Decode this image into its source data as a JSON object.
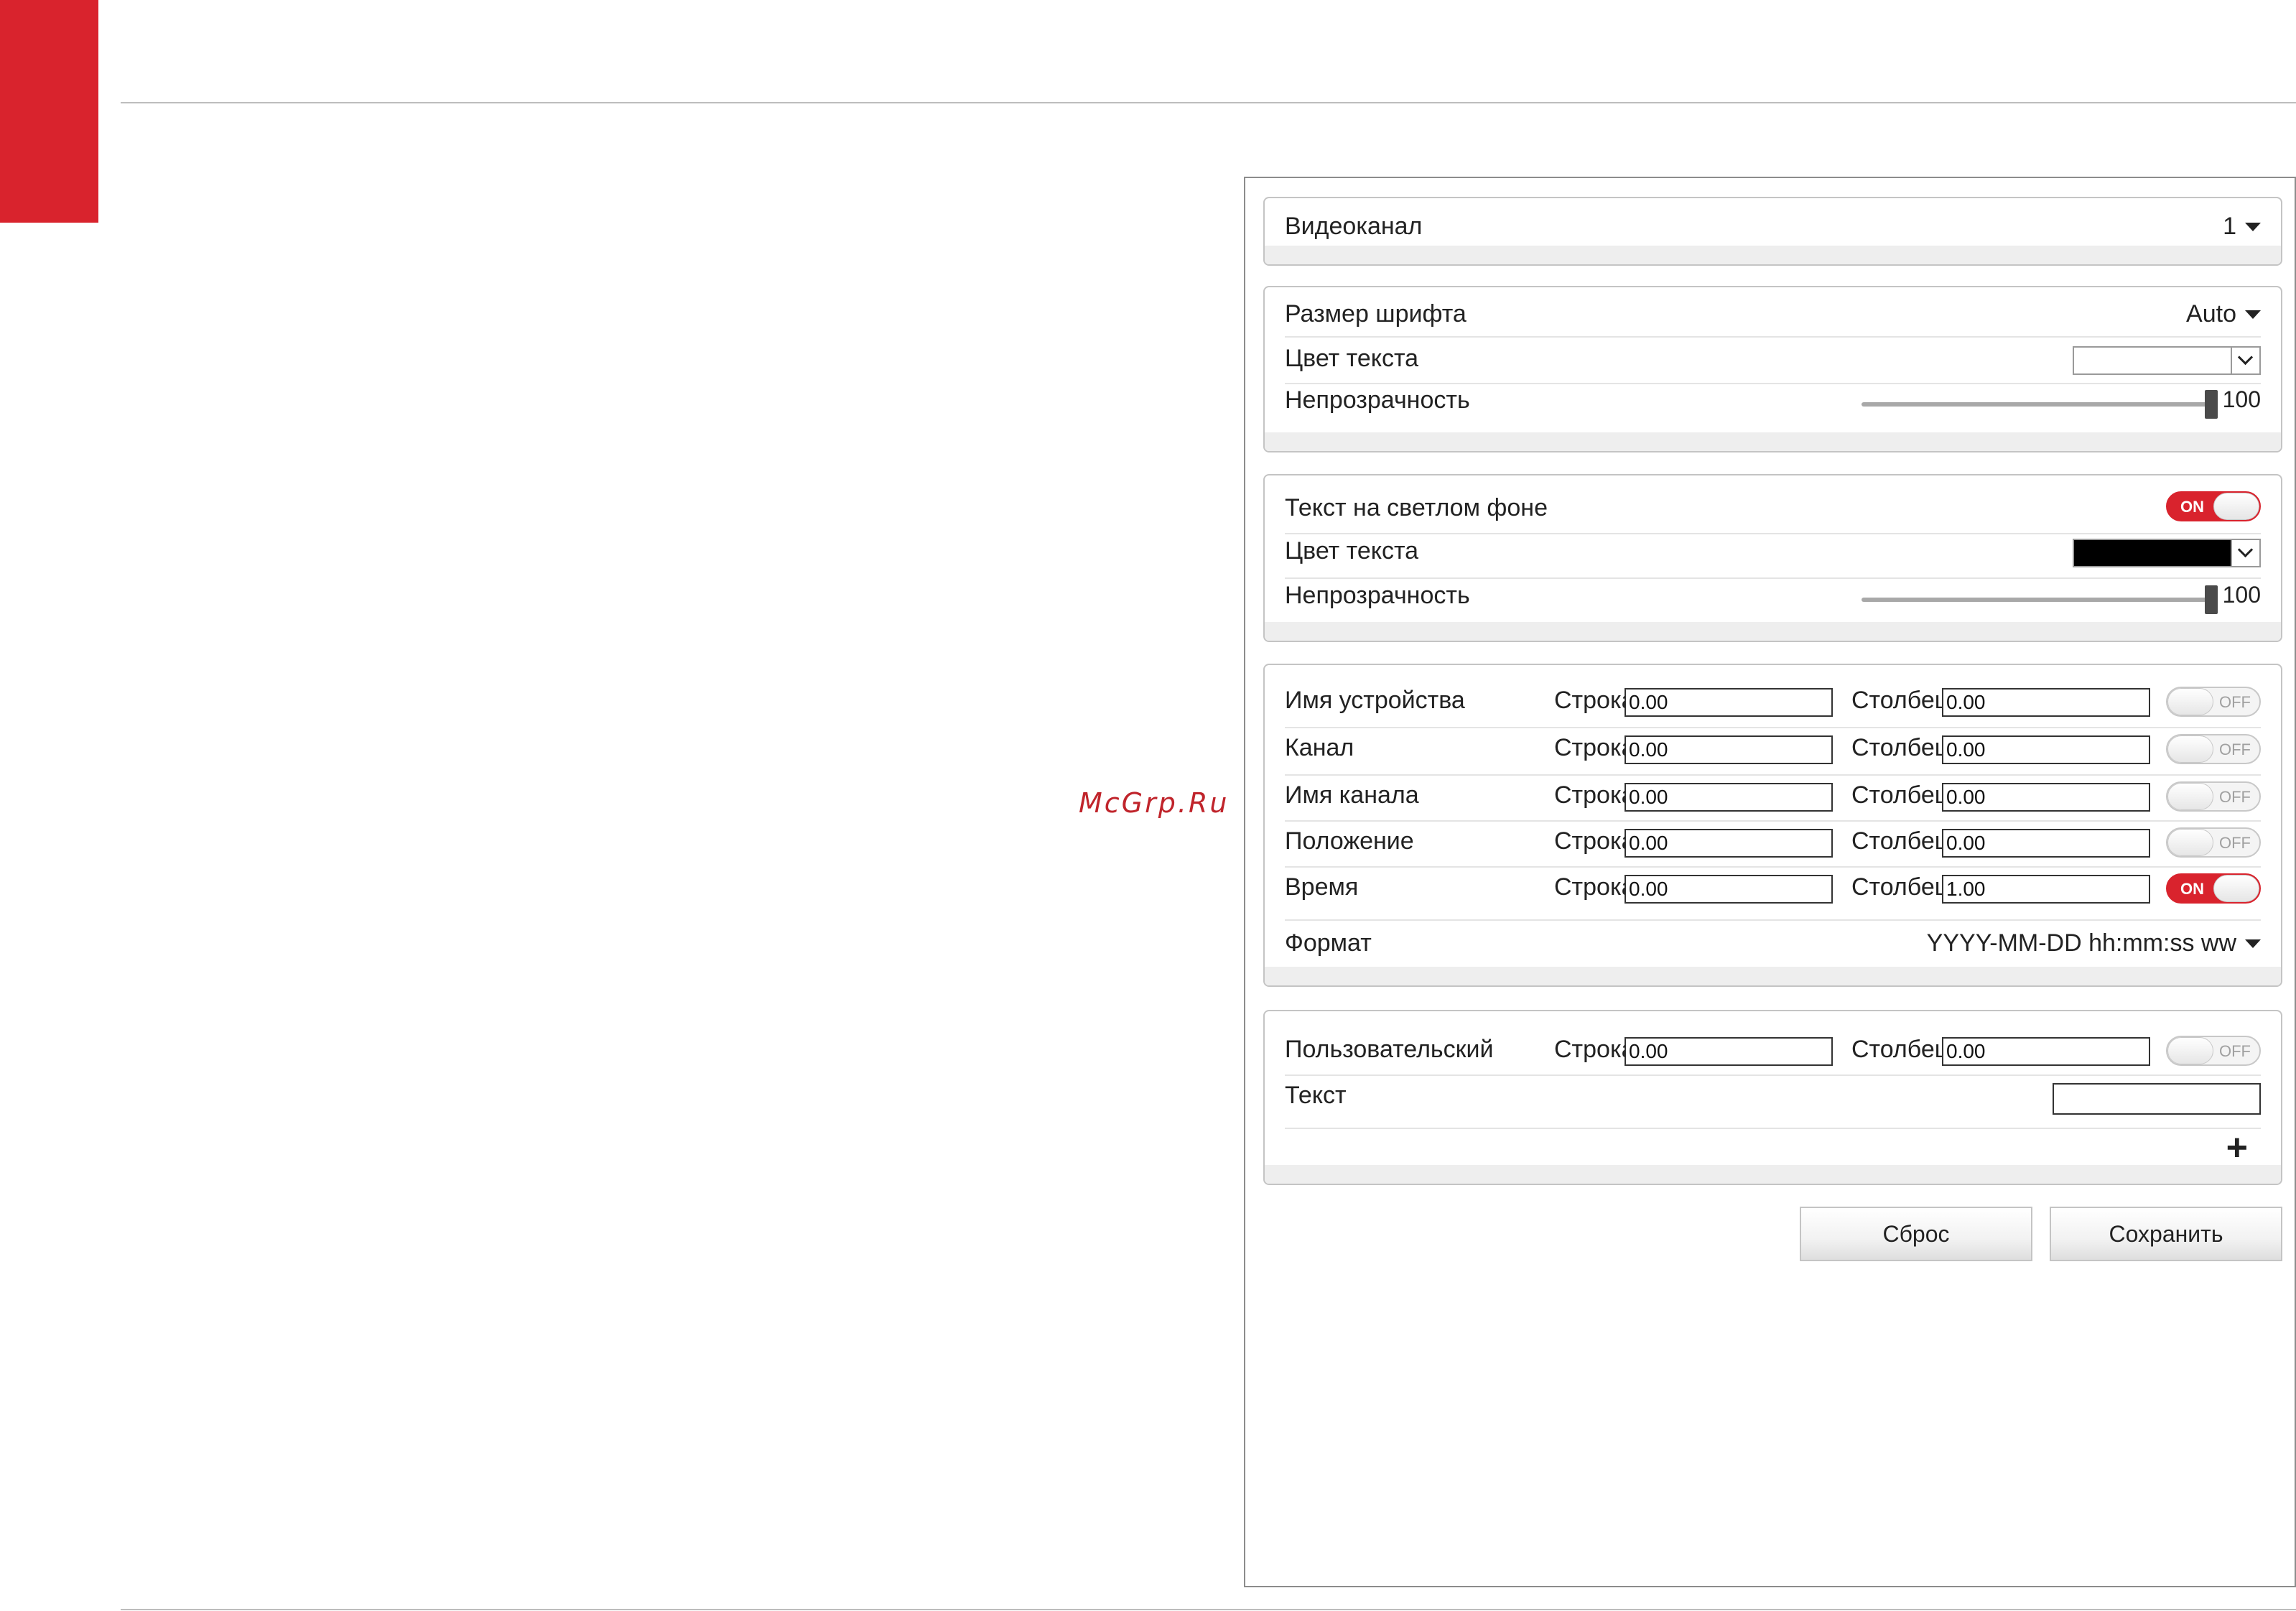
{
  "watermark": "McGrp.Ru",
  "video_channel": {
    "label": "Видеоканал",
    "value": "1"
  },
  "font_settings": {
    "font_size_label": "Размер шрифта",
    "font_size_value": "Auto",
    "text_color_label": "Цвет текста",
    "text_color_value": "#ffffff",
    "opacity_label": "Непрозрачность",
    "opacity_value": "100"
  },
  "light_bg": {
    "label": "Текст на светлом фоне",
    "toggle": "ON",
    "text_color_label": "Цвет текста",
    "text_color_value": "#000000",
    "opacity_label": "Непрозрачность",
    "opacity_value": "100"
  },
  "overlay": {
    "row_label": "Строка",
    "col_label": "Столбец",
    "items": [
      {
        "name": "Имя устройства",
        "row": "0.00",
        "col": "0.00",
        "toggle": "OFF"
      },
      {
        "name": "Канал",
        "row": "0.00",
        "col": "0.00",
        "toggle": "OFF"
      },
      {
        "name": "Имя канала",
        "row": "0.00",
        "col": "0.00",
        "toggle": "OFF"
      },
      {
        "name": "Положение",
        "row": "0.00",
        "col": "0.00",
        "toggle": "OFF"
      },
      {
        "name": "Время",
        "row": "0.00",
        "col": "1.00",
        "toggle": "ON"
      }
    ],
    "format_label": "Формат",
    "format_value": "YYYY-MM-DD hh:mm:ss ww"
  },
  "custom": {
    "name": "Пользовательский",
    "row": "0.00",
    "col": "0.00",
    "toggle": "OFF",
    "text_label": "Текст",
    "text_value": "",
    "add_icon": "plus-icon"
  },
  "buttons": {
    "reset": "Сброс",
    "save": "Сохранить"
  },
  "colors": {
    "accent": "#d9232d"
  }
}
